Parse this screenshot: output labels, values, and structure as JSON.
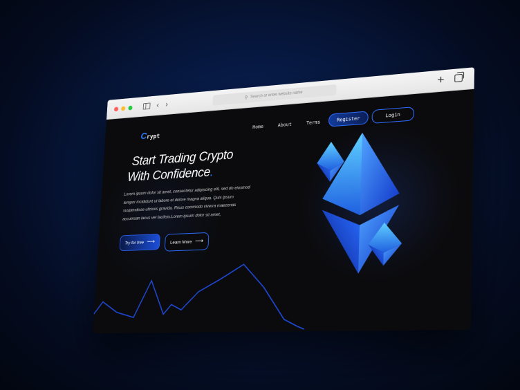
{
  "browser": {
    "address_placeholder": "Search or enter website name"
  },
  "site": {
    "logo_initial": "C",
    "logo_rest": "rypt",
    "nav": [
      "Home",
      "About",
      "Terms"
    ],
    "register_label": "Register",
    "login_label": "Login"
  },
  "hero": {
    "headline_line1": "Start Trading Crypto",
    "headline_line2": "With Confidence",
    "headline_period": ".",
    "paragraph": "Lorem ipsum dolor sit amet, consectetur adipiscing elit, sed do eiusmod tempor incididunt ut labore et dolore magna aliqua. Quis ipsum suspendisse ultrices gravida. Risus commodo viverra maecenas accumsan lacus vel facilisis.Lorem ipsum dolor sit amet,",
    "try_label": "Try for free",
    "learn_label": "Learn More"
  },
  "colors": {
    "accent": "#2f7bff",
    "background": "#0b0b0d"
  },
  "icons": [
    "search-icon",
    "sidebar-icon",
    "back-icon",
    "forward-icon",
    "plus-icon",
    "tabs-icon",
    "arrow-right-icon",
    "ethereum-icon"
  ]
}
